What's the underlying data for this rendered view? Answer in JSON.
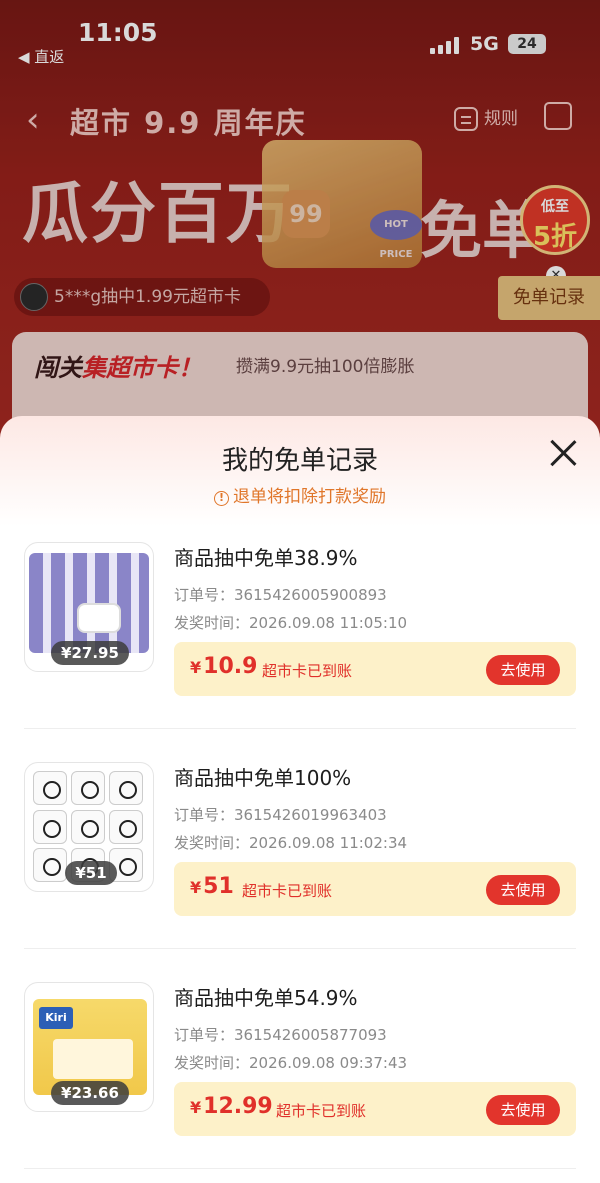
{
  "status_bar": {
    "time": "11:05",
    "back_label": "◀ 直返",
    "network": "5G",
    "battery": "24"
  },
  "background": {
    "event_title": "超市 9.9 周年庆",
    "rules_label": "规则",
    "big_title_left": "瓜分百万",
    "big_title_right": "免单",
    "badge_99": "99",
    "hot_price": "HOT PRICE",
    "discount_line1": "低至",
    "discount_line2": "5折",
    "winner_text": "5***g抽中1.99元超市卡",
    "record_button": "免单记录",
    "task_title_prefix": "闯关",
    "task_title_highlight": "集超市卡！",
    "task_desc": "攒满9.9元抽100倍膨胀"
  },
  "sheet": {
    "title": "我的免单记录",
    "notice": "退单将扣除打款奖励",
    "records": [
      {
        "title": "商品抽中免单38.9%",
        "order_label": "订单号：",
        "order_no": "3615426005900893",
        "time_label": "发奖时间：",
        "time": "2026.09.08 11:05:10",
        "price_tag": "¥27.95",
        "currency": "¥",
        "amount": "10.9",
        "status": "超市卡已到账",
        "button": "去使用"
      },
      {
        "title": "商品抽中免单100%",
        "order_label": "订单号：",
        "order_no": "3615426019963403",
        "time_label": "发奖时间：",
        "time": "2026.09.08 11:02:34",
        "price_tag": "¥51",
        "currency": "¥",
        "amount": "51",
        "status": "超市卡已到账",
        "button": "去使用"
      },
      {
        "title": "商品抽中免单54.9%",
        "order_label": "订单号：",
        "order_no": "3615426005877093",
        "time_label": "发奖时间：",
        "time": "2026.09.08 09:37:43",
        "price_tag": "¥23.66",
        "currency": "¥",
        "amount": "12.99",
        "status": "超市卡已到账",
        "button": "去使用",
        "brand": "Kiri"
      }
    ]
  },
  "colors": {
    "accent_red": "#e2342c",
    "reward_bg": "#fdf1c9",
    "notice_orange": "#e0762a"
  }
}
